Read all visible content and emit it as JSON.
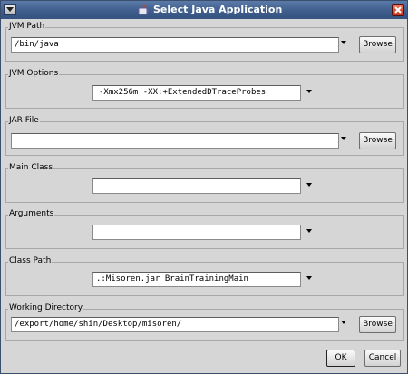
{
  "window": {
    "title": "Select Java Application",
    "app_icon": "java-icon",
    "menu_icon": "chevron-down-icon",
    "close_icon": "close-icon",
    "title_color": "#4a6a98"
  },
  "groups": {
    "jvm_path": {
      "label": "JVM Path",
      "value": "/bin/java",
      "browse_label": "Browse"
    },
    "jvm_options": {
      "label": "JVM Options",
      "value": "-Xmx256m -XX:+ExtendedDTraceProbes"
    },
    "jar_file": {
      "label": "JAR File",
      "value": "",
      "browse_label": "Browse"
    },
    "main_class": {
      "label": "Main Class",
      "value": ""
    },
    "arguments": {
      "label": "Arguments",
      "value": ""
    },
    "class_path": {
      "label": "Class Path",
      "value": ".:Misoren.jar BrainTrainingMain"
    },
    "working_directory": {
      "label": "Working Directory",
      "value": "/export/home/shin/Desktop/misoren/",
      "browse_label": "Browse"
    }
  },
  "footer": {
    "ok_label": "OK",
    "cancel_label": "Cancel"
  }
}
